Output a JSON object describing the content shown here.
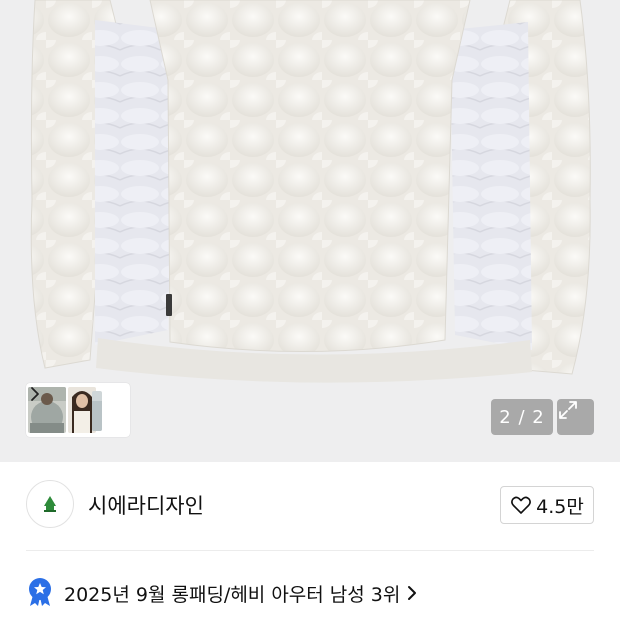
{
  "gallery": {
    "counter": "2 / 2",
    "image_description_icon": "puffer-jacket-photo",
    "thumbnails": [
      "thumbnail-1",
      "thumbnail-2",
      "thumbnail-3"
    ]
  },
  "brand": {
    "name": "시에라디자인",
    "logo_icon": "sierra-designs-logo",
    "likes": "4.5만"
  },
  "ranking": {
    "text": "2025년 9월 롱패딩/헤비 아우터 남성 3위",
    "badge_icon": "ribbon-star-icon"
  },
  "colors": {
    "badge_blue": "#2b6fe6",
    "overlay_gray": "#8c8c8c"
  }
}
